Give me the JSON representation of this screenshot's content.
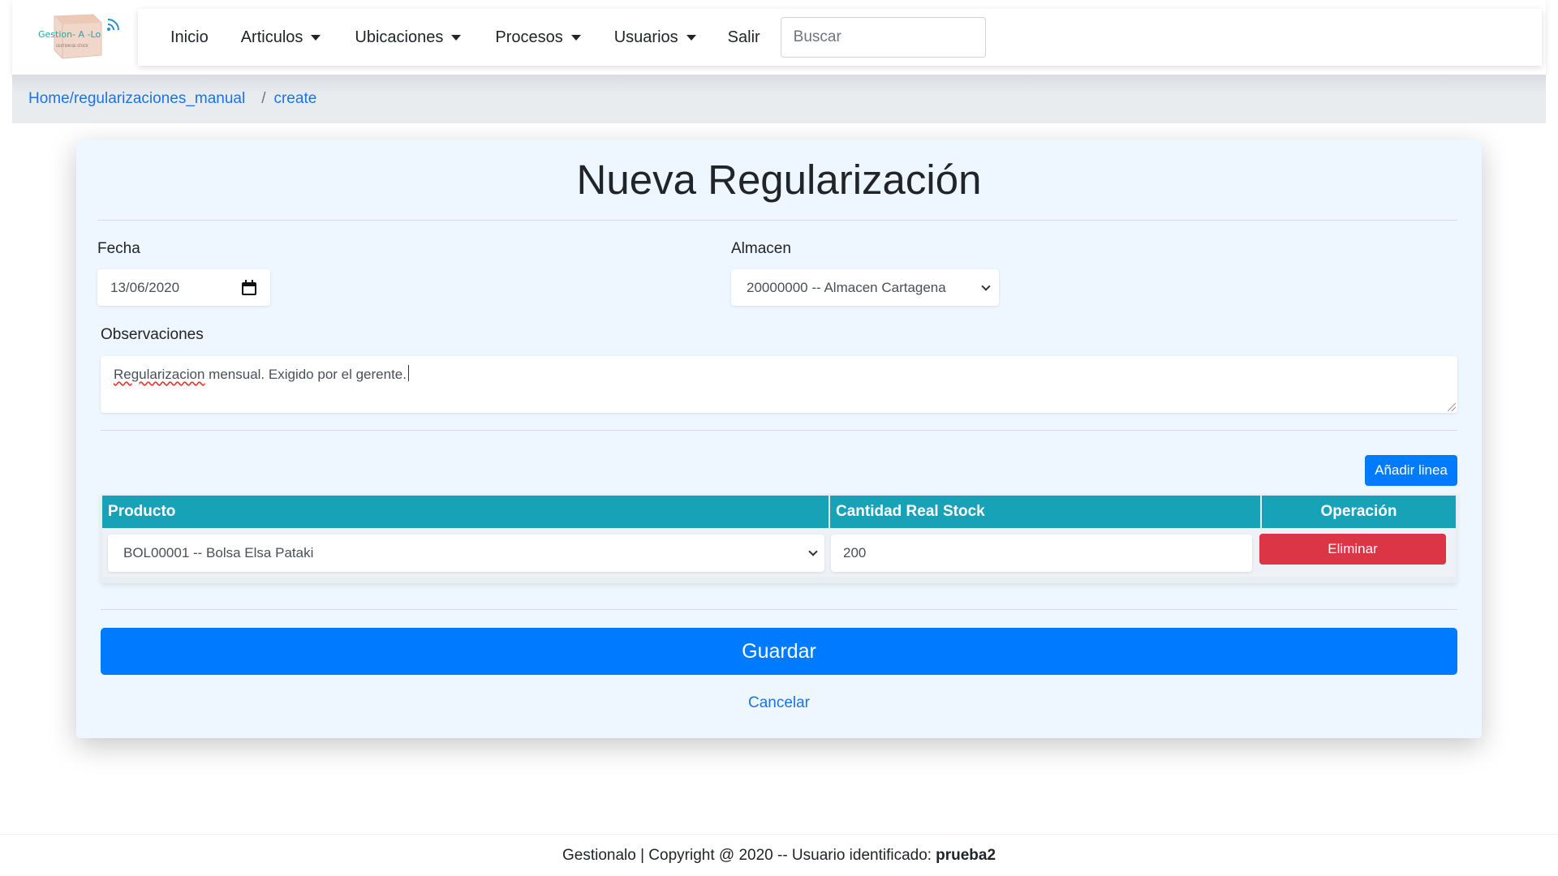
{
  "brand": {
    "logo_text": "Gestion- A -Lo",
    "logo_subtext": "GESTION DE STOCK"
  },
  "nav": {
    "inicio": "Inicio",
    "articulos": "Articulos",
    "ubicaciones": "Ubicaciones",
    "procesos": "Procesos",
    "usuarios": "Usuarios",
    "salir": "Salir",
    "search_placeholder": "Buscar"
  },
  "breadcrumb": {
    "home": "Home/regularizaciones_manual",
    "separator": "/",
    "current": "create"
  },
  "form": {
    "title": "Nueva Regularización",
    "fecha_label": "Fecha",
    "fecha_value": "13/06/2020",
    "almacen_label": "Almacen",
    "almacen_value": "20000000 -- Almacen Cartagena",
    "observaciones_label": "Observaciones",
    "observaciones_word1": "Regularizacion",
    "observaciones_rest": " mensual. Exigido por el gerente.",
    "add_line_label": "Añadir linea",
    "table": {
      "headers": {
        "producto": "Producto",
        "cantidad": "Cantidad Real Stock",
        "operacion": "Operación"
      },
      "rows": [
        {
          "producto": "BOL00001 -- Bolsa Elsa Pataki",
          "cantidad": "200",
          "eliminar": "Eliminar"
        }
      ]
    },
    "guardar_label": "Guardar",
    "cancelar_label": "Cancelar"
  },
  "footer": {
    "text": "Gestionalo | Copyright @ 2020 -- Usuario identificado:",
    "user": "prueba2"
  },
  "colors": {
    "primary": "#007bff",
    "info": "#17a2b8",
    "danger": "#dc3545",
    "card_bg": "#eef6ff"
  }
}
